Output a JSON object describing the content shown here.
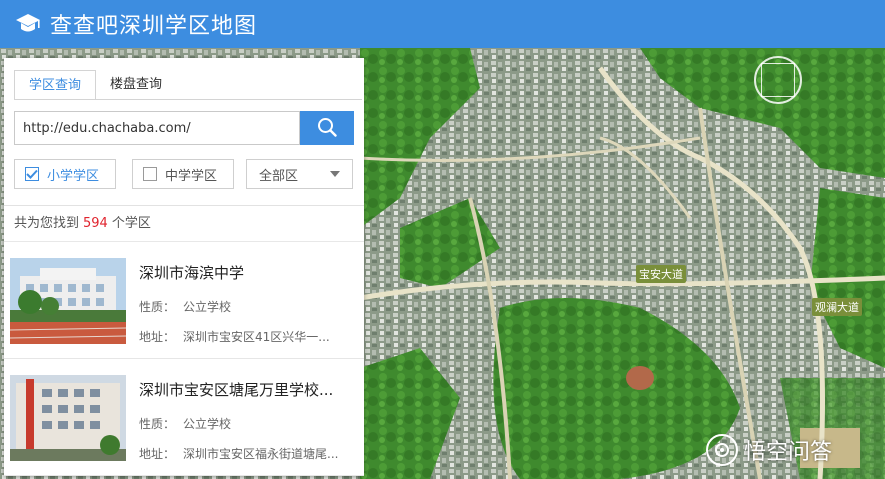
{
  "header": {
    "title": "查查吧深圳学区地图",
    "logo_icon": "graduation-cap-icon"
  },
  "tabs": [
    {
      "label": "学区查询",
      "active": true
    },
    {
      "label": "楼盘查询",
      "active": false
    }
  ],
  "search": {
    "value": "http://edu.chachaba.com/",
    "button_icon": "search-icon"
  },
  "filters": {
    "primary": {
      "label": "小学学区",
      "checked": true
    },
    "middle": {
      "label": "中学学区",
      "checked": false
    },
    "district": {
      "selected": "全部区"
    }
  },
  "results": {
    "prefix": "共为您找到",
    "count": "594",
    "suffix": "个学区",
    "items": [
      {
        "name": "深圳市海滨中学",
        "type_label": "性质：",
        "type": "公立学校",
        "addr_label": "地址：",
        "addr": "深圳市宝安区41区兴华一..."
      },
      {
        "name": "深圳市宝安区塘尾万里学校...",
        "type_label": "性质：",
        "type": "公立学校",
        "addr_label": "地址：",
        "addr": "深圳市宝安区福永街道塘尾..."
      }
    ]
  },
  "map": {
    "road_labels": [
      "宝安大道",
      "观澜大道"
    ],
    "watermark": "悟空问答"
  },
  "colors": {
    "header": "#3d8de0",
    "accent": "#3d8de0",
    "count": "#e0242e"
  }
}
